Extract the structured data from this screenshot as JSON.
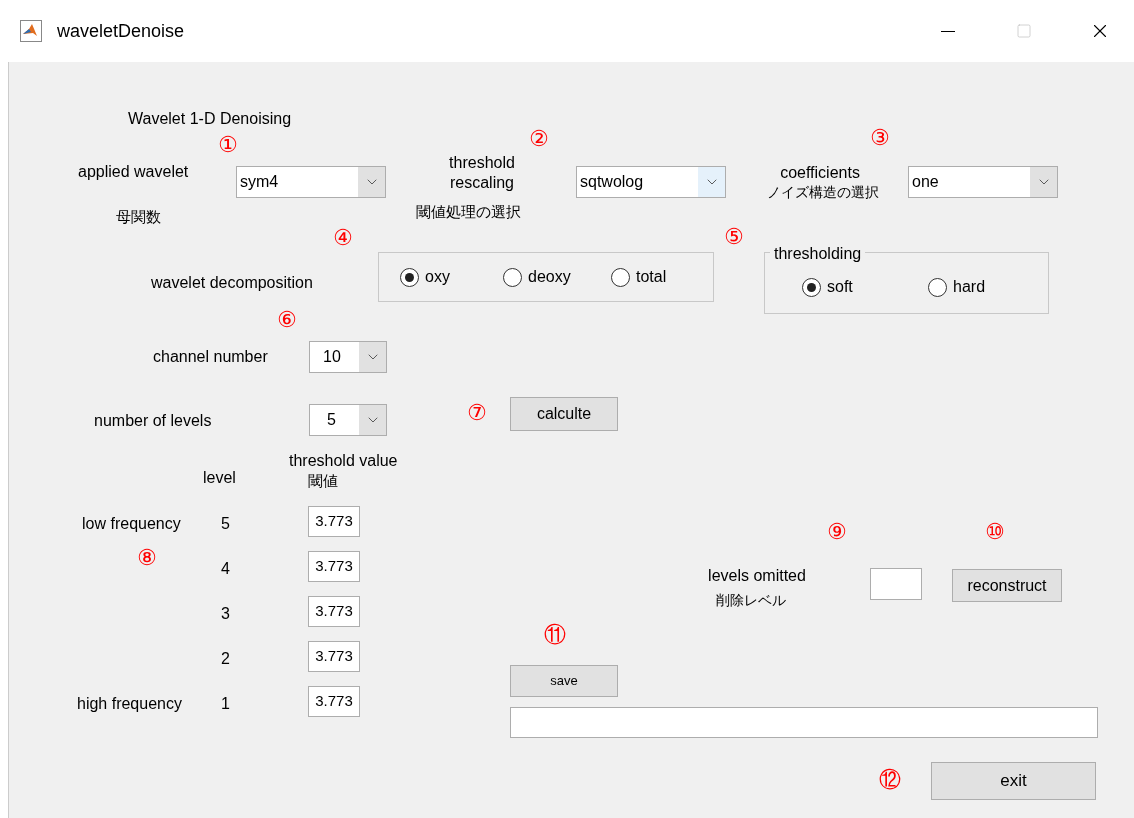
{
  "window": {
    "title": "waveletDenoise"
  },
  "heading": "Wavelet 1-D Denoising",
  "wavelet": {
    "label": "applied wavelet",
    "sublabel": "母関数",
    "value": "sym4",
    "hovered": false
  },
  "threshold_rule": {
    "label": "threshold rescaling",
    "sublabel": "閾値処理の選択",
    "value": "sqtwolog",
    "hovered": true
  },
  "noise_structure": {
    "label": "coefficients",
    "sublabel": "ノイズ構造の選択",
    "value": "one",
    "hovered": false
  },
  "decomposition": {
    "label": "wavelet decomposition",
    "options": [
      {
        "label": "oxy",
        "selected": true
      },
      {
        "label": "deoxy",
        "selected": false
      },
      {
        "label": "total",
        "selected": false
      }
    ]
  },
  "thresholding": {
    "title": "thresholding",
    "options": [
      {
        "label": "soft",
        "selected": true
      },
      {
        "label": "hard",
        "selected": false
      }
    ]
  },
  "channel": {
    "label": "channel number",
    "value": "10"
  },
  "levels": {
    "label": "number of levels",
    "value": "5"
  },
  "calculate_button": "calculte",
  "table": {
    "level_header": "level",
    "value_header": "threshold value",
    "value_subheader": "閾値",
    "rows": [
      {
        "band": "low frequency",
        "level": "5",
        "value": "3.773"
      },
      {
        "level": "4",
        "value": "3.773"
      },
      {
        "level": "3",
        "value": "3.773"
      },
      {
        "level": "2",
        "value": "3.773"
      },
      {
        "band": "high frequency",
        "level": "1",
        "value": "3.773"
      }
    ]
  },
  "omit": {
    "label": "levels omitted",
    "sublabel": "削除レベル"
  },
  "reconstruct_button": "reconstruct",
  "save_button": "save",
  "exit_button": "exit",
  "markers": [
    "①",
    "②",
    "③",
    "④",
    "⑤",
    "⑥",
    "⑦",
    "⑧",
    "⑨",
    "⑩",
    "⑪",
    "⑫"
  ]
}
